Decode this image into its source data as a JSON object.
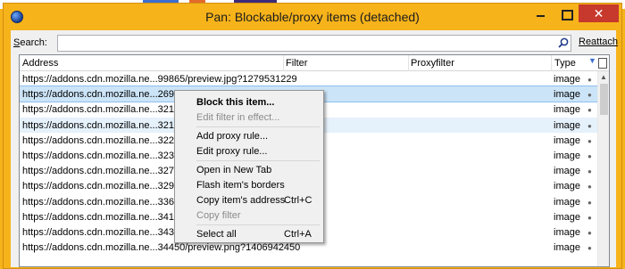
{
  "window": {
    "title": "Pan: Blockable/proxy items (detached)",
    "close_glyph": "✕"
  },
  "search": {
    "label_prefix": "S",
    "label_rest": "earch:",
    "value": "",
    "reattach": "Reattach"
  },
  "columns": {
    "address": "Address",
    "filter": "Filter",
    "proxyfilter": "Proxyfilter",
    "type": "Type"
  },
  "rows": [
    {
      "address": "https://addons.cdn.mozilla.ne...99865/preview.jpg?1279531229",
      "type": "image"
    },
    {
      "address": "https://addons.cdn.mozilla.ne...26964/preview.png?1404174030",
      "type": "image"
    },
    {
      "address": "https://addons.cdn.mozilla.ne...32114/",
      "type": "image"
    },
    {
      "address": "https://addons.cdn.mozilla.ne...32160/",
      "type": "image"
    },
    {
      "address": "https://addons.cdn.mozilla.ne...32218/",
      "type": "image"
    },
    {
      "address": "https://addons.cdn.mozilla.ne...32376/",
      "type": "image"
    },
    {
      "address": "https://addons.cdn.mozilla.ne...32742/",
      "type": "image"
    },
    {
      "address": "https://addons.cdn.mozilla.ne...32950/",
      "type": "image"
    },
    {
      "address": "https://addons.cdn.mozilla.ne...33690/",
      "type": "image"
    },
    {
      "address": "https://addons.cdn.mozilla.ne...34162/",
      "type": "image"
    },
    {
      "address": "https://addons.cdn.mozilla.ne...34360/",
      "type": "image"
    },
    {
      "address": "https://addons.cdn.mozilla.ne...34450/preview.png?1406942450",
      "type": "image"
    }
  ],
  "context_menu": {
    "block_item": "Block this item...",
    "edit_filter": "Edit filter in effect...",
    "add_proxy_rule": "Add proxy rule...",
    "edit_proxy_rule": "Edit proxy rule...",
    "open_new_tab": "Open in New Tab",
    "flash_borders": "Flash item's borders",
    "copy_address": "Copy item's address",
    "copy_address_shortcut": "Ctrl+C",
    "copy_filter": "Copy filter",
    "select_all": "Select all",
    "select_all_shortcut": "Ctrl+A"
  },
  "colors": {
    "window_frame": "#f7b31a",
    "close_button": "#c7392c",
    "selected_row": "#cce4f7"
  },
  "icons": {
    "app": "globe-icon",
    "search": "magnifier-icon",
    "minimize": "minimize-icon",
    "maximize": "maximize-icon",
    "close": "close-icon"
  }
}
